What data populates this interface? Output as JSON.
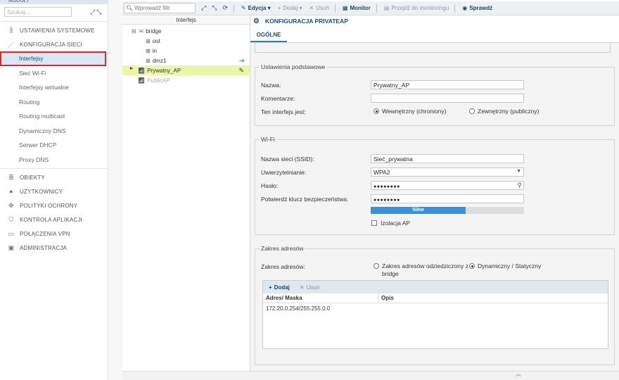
{
  "sidebar": {
    "top_label": "MODUŁY",
    "search_placeholder": "Szukaj...",
    "sections": [
      {
        "label": "USTAWIENIA SYSTEMOWE"
      },
      {
        "label": "KONFIGURACJA SIECI"
      }
    ],
    "network_items": [
      "Interfejsy",
      "Sieć Wi-Fi",
      "Interfejsy wirtualne",
      "Routing",
      "Routing multicast",
      "Dynamiczny DNS",
      "Serwer DHCP",
      "Proxy DNS"
    ],
    "bottom_sections": [
      "OBIEKTY",
      "UŻYTKOWNICY",
      "POLITYKI OCHRONY",
      "KONTROLA APLIKACJI",
      "POŁĄCZENIA VPN",
      "ADMINISTRACJA"
    ]
  },
  "toolbar": {
    "filter_placeholder": "Wprowadź filtr",
    "edit": "Edycja",
    "add": "Dodaj",
    "remove": "Usuń",
    "monitor": "Monitor",
    "goto_monitoring": "Przejdź do monitoringu",
    "check": "Sprawdź"
  },
  "tree": {
    "header": "Interfejs",
    "items": {
      "bridge": "bridge",
      "out": "out",
      "in": "in",
      "dmz1": "dmz1",
      "private_ap": "Prywatny_AP",
      "public_ap": "PublicAP"
    }
  },
  "panel": {
    "title": "KONFIGURACJA PRIVATEAP",
    "tab": "OGÓLNE",
    "basic": {
      "legend": "Ustawienia podstawowe",
      "name_label": "Nazwa:",
      "name_value": "Prywatny_AP",
      "comment_label": "Komentarze:",
      "comment_value": "",
      "iface_label": "Ten interfejs jest:",
      "internal": "Wewnętrzny (chroniony)",
      "external": "Zewnętrzny (publiczny)"
    },
    "wifi": {
      "legend": "Wi-Fi",
      "ssid_label": "Nazwa sieci (SSID):",
      "ssid_value": "Sieć_prywatna",
      "auth_label": "Uwierzytelnianie:",
      "auth_value": "WPA2",
      "pass_label": "Hasło:",
      "pass_value": "●●●●●●●●",
      "confirm_label": "Potwierdź klucz bezpieczeństwa:",
      "confirm_value": "●●●●●●●●",
      "strength_label": "Silne",
      "strength_fraction": 0.62,
      "isolation_label": "Izolacja AP"
    },
    "addresses": {
      "legend": "Zakres adresów",
      "range_label": "Zakres adresów:",
      "inherit_line1": "Zakres adresów odziedziczony z",
      "inherit_line2": "bridge",
      "dynamic": "Dynamiczny / Statyczny",
      "add": "Dodaj",
      "remove": "Usuń",
      "col_address": "Adres/ Maska",
      "col_desc": "Opis",
      "rows": [
        {
          "address": "172.20.0.254/255.255.0.0",
          "desc": ""
        }
      ]
    }
  }
}
